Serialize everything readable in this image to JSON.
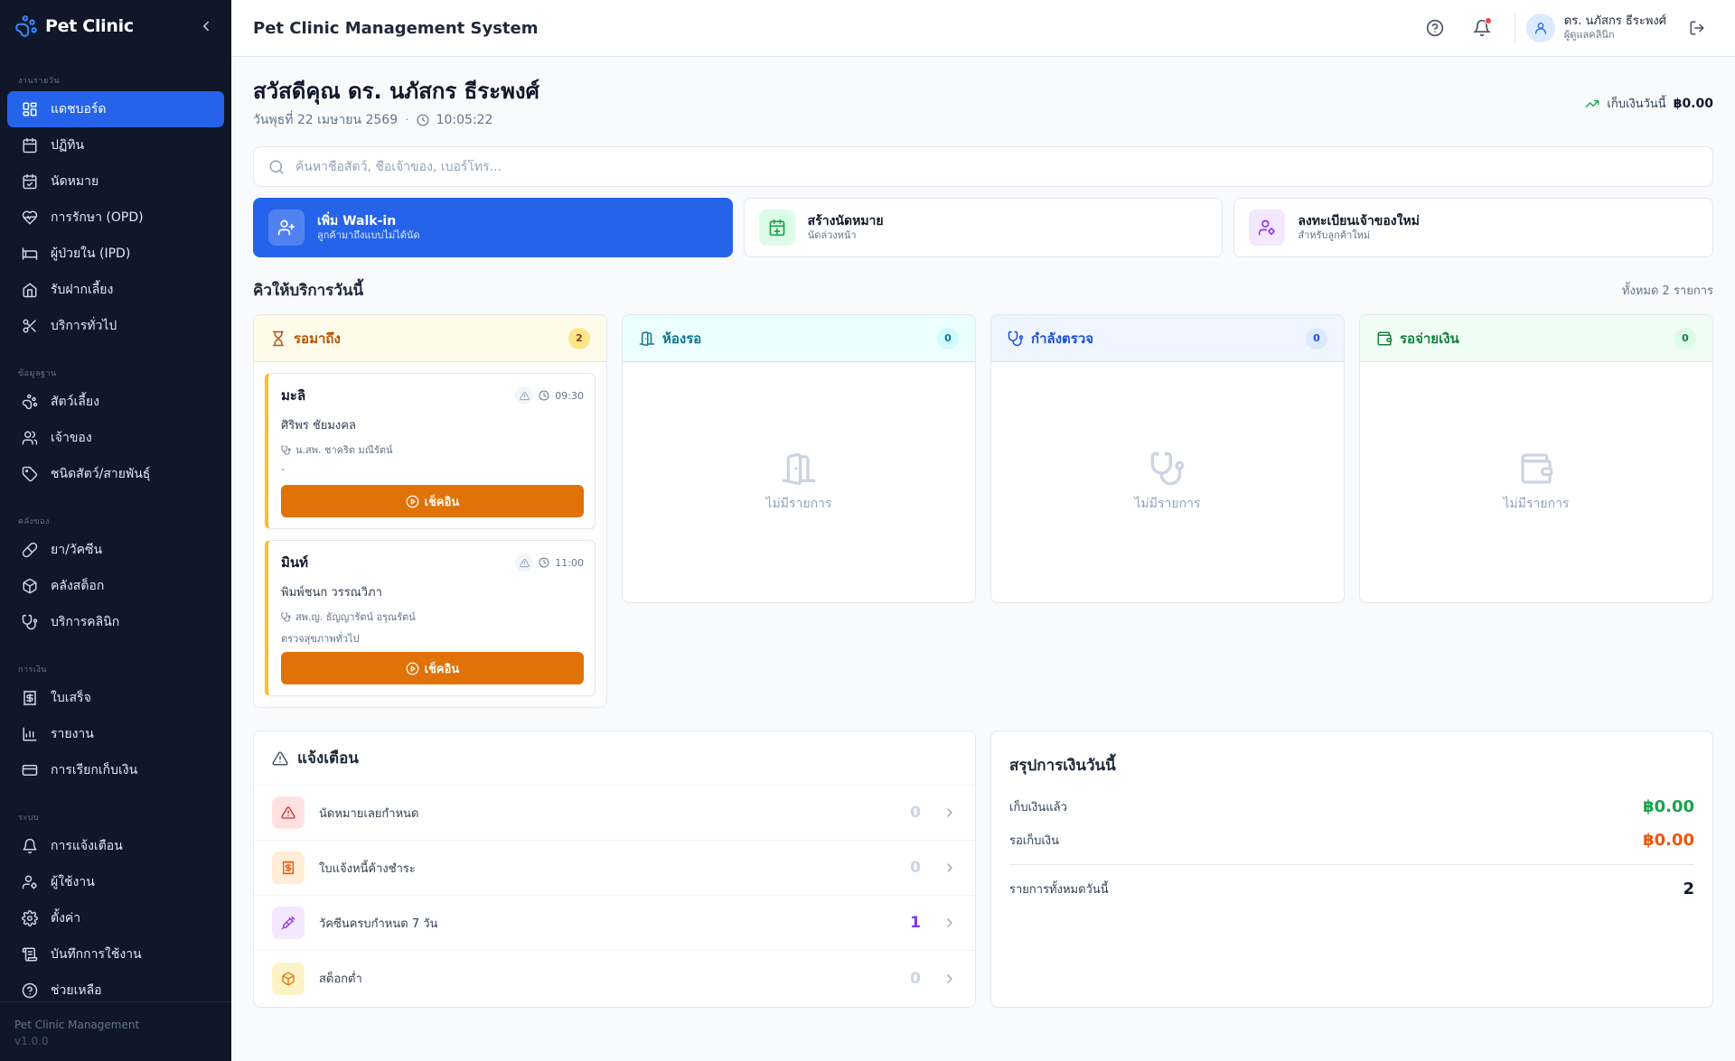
{
  "brand": {
    "name": "Pet Clinic"
  },
  "sidebar": {
    "sections": [
      {
        "title": "งานรายวัน",
        "items": [
          {
            "label": "แดชบอร์ด",
            "icon": "dashboard-icon",
            "active": true
          },
          {
            "label": "ปฏิทิน",
            "icon": "calendar-icon"
          },
          {
            "label": "นัดหมาย",
            "icon": "calendar-check-icon"
          },
          {
            "label": "การรักษา (OPD)",
            "icon": "heart-pulse-icon"
          },
          {
            "label": "ผู้ป่วยใน (IPD)",
            "icon": "bed-icon"
          },
          {
            "label": "รับฝากเลี้ยง",
            "icon": "home-icon"
          },
          {
            "label": "บริการทั่วไป",
            "icon": "scissors-icon"
          }
        ]
      },
      {
        "title": "ข้อมูลฐาน",
        "items": [
          {
            "label": "สัตว์เลี้ยง",
            "icon": "paw-icon"
          },
          {
            "label": "เจ้าของ",
            "icon": "users-icon"
          },
          {
            "label": "ชนิดสัตว์/สายพันธุ์",
            "icon": "tag-icon"
          }
        ]
      },
      {
        "title": "คลังของ",
        "items": [
          {
            "label": "ยา/วัคซีน",
            "icon": "pill-icon"
          },
          {
            "label": "คลังสต็อก",
            "icon": "package-icon"
          },
          {
            "label": "บริการคลินิก",
            "icon": "stethoscope-icon"
          }
        ]
      },
      {
        "title": "การเงิน",
        "items": [
          {
            "label": "ใบเสร็จ",
            "icon": "receipt-icon"
          },
          {
            "label": "รายงาน",
            "icon": "bar-chart-icon"
          },
          {
            "label": "การเรียกเก็บเงิน",
            "icon": "credit-card-icon"
          }
        ]
      },
      {
        "title": "ระบบ",
        "items": [
          {
            "label": "การแจ้งเตือน",
            "icon": "bell-icon"
          },
          {
            "label": "ผู้ใช้งาน",
            "icon": "user-cog-icon"
          },
          {
            "label": "ตั้งค่า",
            "icon": "gear-icon"
          },
          {
            "label": "บันทึกการใช้งาน",
            "icon": "scroll-icon"
          },
          {
            "label": "ช่วยเหลือ",
            "icon": "help-icon"
          }
        ]
      }
    ],
    "footer": {
      "app": "Pet Clinic Management",
      "version": "v1.0.0"
    }
  },
  "header": {
    "title": "Pet Clinic Management System",
    "user_name": "ดร. นภัสกร ธีระพงศ์",
    "user_role": "ผู้ดูแลคลินิก"
  },
  "greeting": {
    "title": "สวัสดีคุณ ดร. นภัสกร ธีระพงศ์",
    "date": "วันพุธที่ 22 เมษายน 2569",
    "separator": "·",
    "time": "10:05:22",
    "collected_label": "เก็บเงินวันนี้",
    "collected_value": "฿0.00"
  },
  "search": {
    "placeholder": "ค้นหาชื่อสัตว์, ชื่อเจ้าของ, เบอร์โทร...",
    "value": ""
  },
  "quick_actions": [
    {
      "title": "เพิ่ม Walk-in",
      "subtitle": "ลูกค้ามาถึงแบบไม่ได้นัด",
      "icon": "user-plus-icon"
    },
    {
      "title": "สร้างนัดหมาย",
      "subtitle": "นัดล่วงหน้า",
      "icon": "calendar-plus-icon"
    },
    {
      "title": "ลงทะเบียนเจ้าของใหม่",
      "subtitle": "สำหรับลูกค้าใหม่",
      "icon": "user-cog-icon"
    }
  ],
  "queue": {
    "title": "คิวให้บริการวันนี้",
    "total": "ทั้งหมด 2 รายการ",
    "empty_text": "ไม่มีรายการ",
    "checkin_label": "เช็คอิน",
    "columns": [
      {
        "title": "รอมาถึง",
        "count": "2",
        "icon": "hourglass-icon",
        "color": "#b45309"
      },
      {
        "title": "ห้องรอ",
        "count": "0",
        "icon": "door-icon",
        "color": "#0e7490"
      },
      {
        "title": "กำลังตรวจ",
        "count": "0",
        "icon": "stethoscope-icon",
        "color": "#1d4ed8"
      },
      {
        "title": "รอจ่ายเงิน",
        "count": "0",
        "icon": "wallet-icon",
        "color": "#15803d"
      }
    ],
    "cards": [
      {
        "pet": "มะลิ",
        "time": "09:30",
        "owner": "ศิริพร ชัยมงคล",
        "vet": "น.สพ. ชาคริต มณีรัตน์",
        "note": "-"
      },
      {
        "pet": "มินท์",
        "time": "11:00",
        "owner": "พิมพ์ชนก วรรณวิภา",
        "vet": "สพ.ญ. ธัญญารัตน์ อรุณรัตน์",
        "note": "ตรวจสุขภาพทั่วไป"
      }
    ]
  },
  "alerts": {
    "title": "แจ้งเตือน",
    "items": [
      {
        "label": "นัดหมายเลยกำหนด",
        "count": "0",
        "icon": "alert-triangle-icon"
      },
      {
        "label": "ใบแจ้งหนี้ค้างชำระ",
        "count": "0",
        "icon": "receipt-icon"
      },
      {
        "label": "วัคซีนครบกำหนด 7 วัน",
        "count": "1",
        "icon": "syringe-icon"
      },
      {
        "label": "สต็อกต่ำ",
        "count": "0",
        "icon": "package-icon"
      }
    ]
  },
  "finance": {
    "title": "สรุปการเงินวันนี้",
    "collected_label": "เก็บเงินแล้ว",
    "collected_value": "฿0.00",
    "pending_label": "รอเก็บเงิน",
    "pending_value": "฿0.00",
    "total_label": "รายการทั้งหมดวันนี้",
    "total_value": "2"
  },
  "colors": {
    "primary": "#2563eb",
    "sidebar": "#0f1729",
    "checkin": "#e07208",
    "success": "#16a34a",
    "pending": "#ea580c",
    "vaccine": "#7c3aed"
  }
}
